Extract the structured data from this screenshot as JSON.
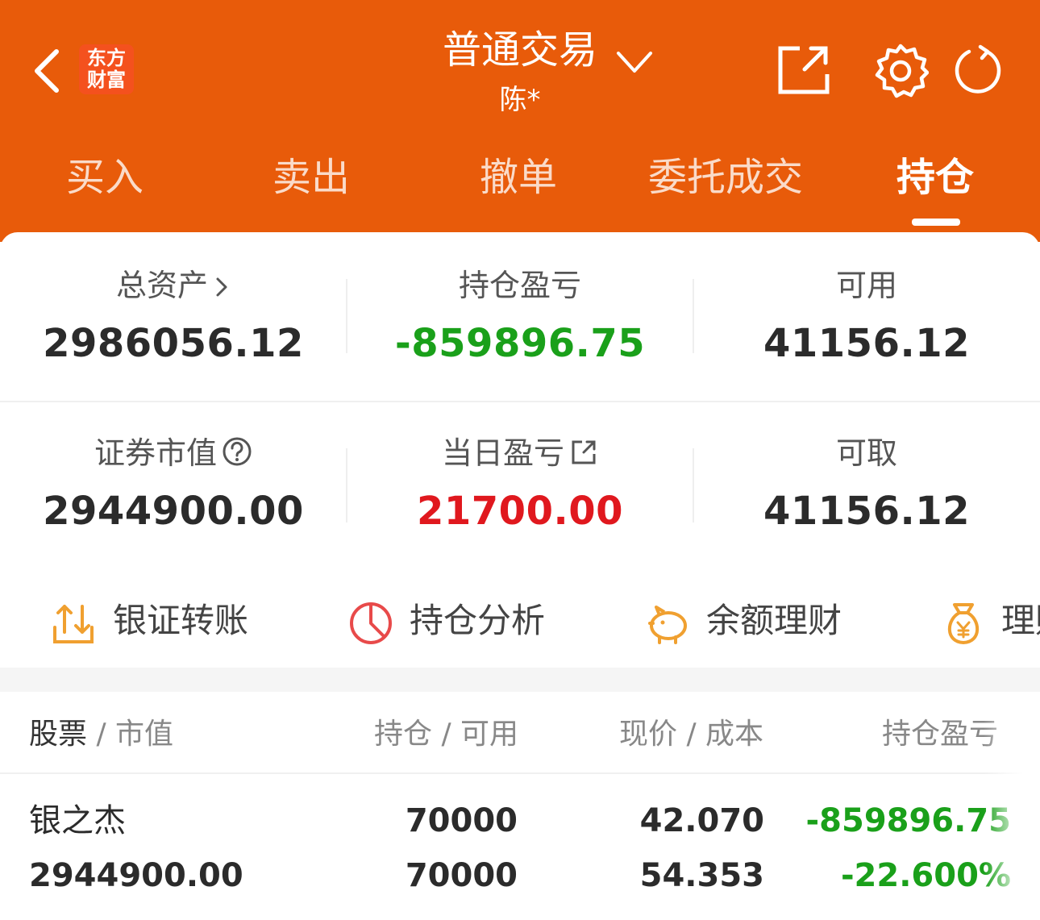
{
  "header": {
    "logo_line1": "东方",
    "logo_line2": "财富",
    "title": "普通交易",
    "account": "陈*",
    "brand_color": "#e85b0a"
  },
  "tabs": [
    {
      "label": "买入"
    },
    {
      "label": "卖出"
    },
    {
      "label": "撤单"
    },
    {
      "label": "委托成交"
    },
    {
      "label": "持仓",
      "active": true
    }
  ],
  "summary": {
    "total_assets": {
      "label": "总资产",
      "value": "2986056.12"
    },
    "position_pnl": {
      "label": "持仓盈亏",
      "value": "-859896.75"
    },
    "available": {
      "label": "可用",
      "value": "41156.12"
    },
    "market_value": {
      "label": "证券市值",
      "value": "2944900.00"
    },
    "daily_pnl": {
      "label": "当日盈亏",
      "value": "21700.00"
    },
    "withdrawable": {
      "label": "可取",
      "value": "41156.12"
    }
  },
  "quick_actions": [
    {
      "label": "银证转账",
      "icon": "transfer-icon"
    },
    {
      "label": "持仓分析",
      "icon": "pie-chart-icon"
    },
    {
      "label": "余额理财",
      "icon": "piggy-bank-icon"
    },
    {
      "label": "理财",
      "icon": "money-bag-icon"
    }
  ],
  "table": {
    "headers": {
      "stock": "股票",
      "market_value": "市值",
      "position": "持仓",
      "available": "可用",
      "price": "现价",
      "cost": "成本",
      "pnl": "持仓盈亏"
    },
    "rows": [
      {
        "name": "银之杰",
        "market_value": "2944900.00",
        "position": "70000",
        "available": "70000",
        "price": "42.070",
        "cost": "54.353",
        "pnl": "-859896.75",
        "pnl_pct": "-22.600%"
      }
    ]
  },
  "colors": {
    "loss": "#1aa01a",
    "gain": "#e0181e"
  }
}
